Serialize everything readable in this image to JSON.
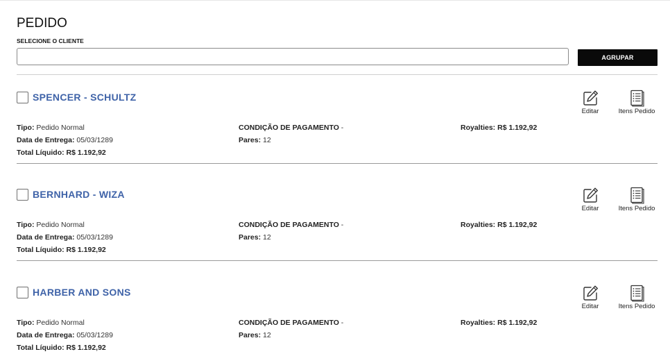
{
  "page": {
    "title": "PEDIDO"
  },
  "client_select": {
    "label": "SELECIONE O CLIENTE",
    "value": "",
    "placeholder": ""
  },
  "group_button": {
    "label": "AGRUPAR"
  },
  "labels": {
    "tipo": "Tipo:",
    "data_entrega": "Data de Entrega:",
    "total_liquido": "Total Líquido:",
    "condicao": "CONDIÇÃO DE PAGAMENTO",
    "pares": "Pares:",
    "royalties": "Royalties:",
    "editar": "Editar",
    "itens_pedido": "Itens Pedido"
  },
  "orders": [
    {
      "client": "SPENCER - SCHULTZ",
      "tipo": "Pedido Normal",
      "data_entrega": "05/03/1289",
      "total_liquido": "R$ 1.192,92",
      "condicao": "-",
      "pares": "12",
      "royalties": "R$ 1.192,92",
      "selected": false
    },
    {
      "client": "BERNHARD - WIZA",
      "tipo": "Pedido Normal",
      "data_entrega": "05/03/1289",
      "total_liquido": "R$ 1.192,92",
      "condicao": "-",
      "pares": "12",
      "royalties": "R$ 1.192,92",
      "selected": false
    },
    {
      "client": "HARBER AND SONS",
      "tipo": "Pedido Normal",
      "data_entrega": "05/03/1289",
      "total_liquido": "R$ 1.192,92",
      "condicao": "-",
      "pares": "12",
      "royalties": "R$ 1.192,92",
      "selected": false
    }
  ],
  "icons": {
    "edit": "edit-icon",
    "items": "list-document-icon"
  },
  "colors": {
    "client_name": "#3f63a8",
    "button_bg": "#0a0a0a",
    "divider": "#9a9a9a"
  }
}
